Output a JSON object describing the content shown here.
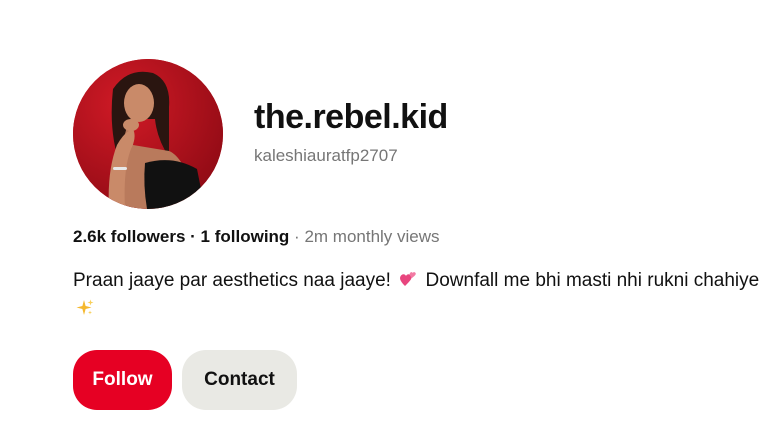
{
  "profile": {
    "display_name": "the.rebel.kid",
    "username": "kaleshiauratfp2707",
    "followers": "2.6k followers",
    "separator": " · ",
    "following": "1 following",
    "views_separator": " · ",
    "monthly_views": "2m monthly views",
    "bio_part1": "Praan jaaye par aesthetics naa jaaye!",
    "bio_part2": " Downfall me bhi masti nhi rukni chahiye",
    "bio_emoji1": "two-hearts-icon",
    "bio_emoji2": "sparkles-icon"
  },
  "actions": {
    "follow_label": "Follow",
    "contact_label": "Contact"
  },
  "colors": {
    "accent": "#e60023",
    "secondary_button": "#e9e9e4",
    "muted_text": "#767676",
    "avatar_background": "#b8101d"
  }
}
